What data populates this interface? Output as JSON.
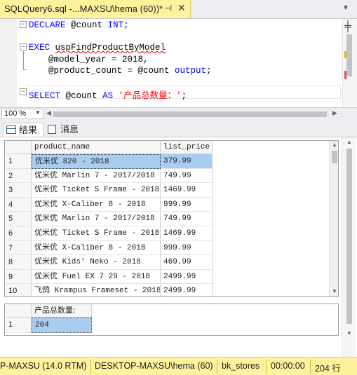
{
  "tab": {
    "title": "SQLQuery6.sql -...MAXSU\\hema (60))*",
    "pin_glyph": "⊣",
    "close_glyph": "✕"
  },
  "editor": {
    "line1_kw": "DECLARE",
    "line1_var": "@count",
    "line1_type": "INT;",
    "line3_kw": "EXEC",
    "line3_proc": "uspFindProductByModel",
    "line4": "@model_year = 2018,",
    "line5_var": "@product_count = @count",
    "line5_kw": "output",
    "line5_end": ";",
    "line7_kw": "SELECT",
    "line7_var": "@count",
    "line7_as": "AS",
    "line7_str": "'产品总数量：'",
    "line7_end": ";"
  },
  "zoom": {
    "value": "100 %"
  },
  "result_tabs": [
    {
      "label": "结果",
      "icon": "grid-icon"
    },
    {
      "label": "消息",
      "icon": "message-icon"
    }
  ],
  "grid1": {
    "columns": [
      "product_name",
      "list_price"
    ],
    "rows": [
      {
        "num": "1",
        "product_name": "优米优 820 - 2018",
        "list_price": "379.99"
      },
      {
        "num": "2",
        "product_name": "优米优 Marlin 7 - 2017/2018",
        "list_price": "749.99"
      },
      {
        "num": "3",
        "product_name": "优米优 Ticket S Frame - 2018",
        "list_price": "1469.99"
      },
      {
        "num": "4",
        "product_name": "优米优 X-Caliber 8 - 2018",
        "list_price": "999.99"
      },
      {
        "num": "5",
        "product_name": "优米优 Marlin 7 - 2017/2018",
        "list_price": "749.99"
      },
      {
        "num": "6",
        "product_name": "优米优 Ticket S Frame - 2018",
        "list_price": "1469.99"
      },
      {
        "num": "7",
        "product_name": "优米优 X-Caliber 8 - 2018",
        "list_price": "999.99"
      },
      {
        "num": "8",
        "product_name": "优米优 Kids' Neko - 2018",
        "list_price": "469.99"
      },
      {
        "num": "9",
        "product_name": "优米优 Fuel EX 7 29 - 2018",
        "list_price": "2499.99"
      },
      {
        "num": "10",
        "product_name": "飞鸽 Krampus Frameset - 2018",
        "list_price": "2499.99"
      }
    ]
  },
  "grid2": {
    "column": "产品总数量:",
    "row_num": "1",
    "value": "204"
  },
  "status": {
    "server": "P-MAXSU (14.0 RTM)",
    "login": "DESKTOP-MAXSU\\hema (60)",
    "database": "bk_stores",
    "time": "00:00:00",
    "rows": "204 行"
  },
  "colors": {
    "tab_bg": "#fff29d",
    "status_bg": "#fff29d",
    "keyword": "#0000ff",
    "string": "#ff0000",
    "selection": "#a8cdf0"
  }
}
